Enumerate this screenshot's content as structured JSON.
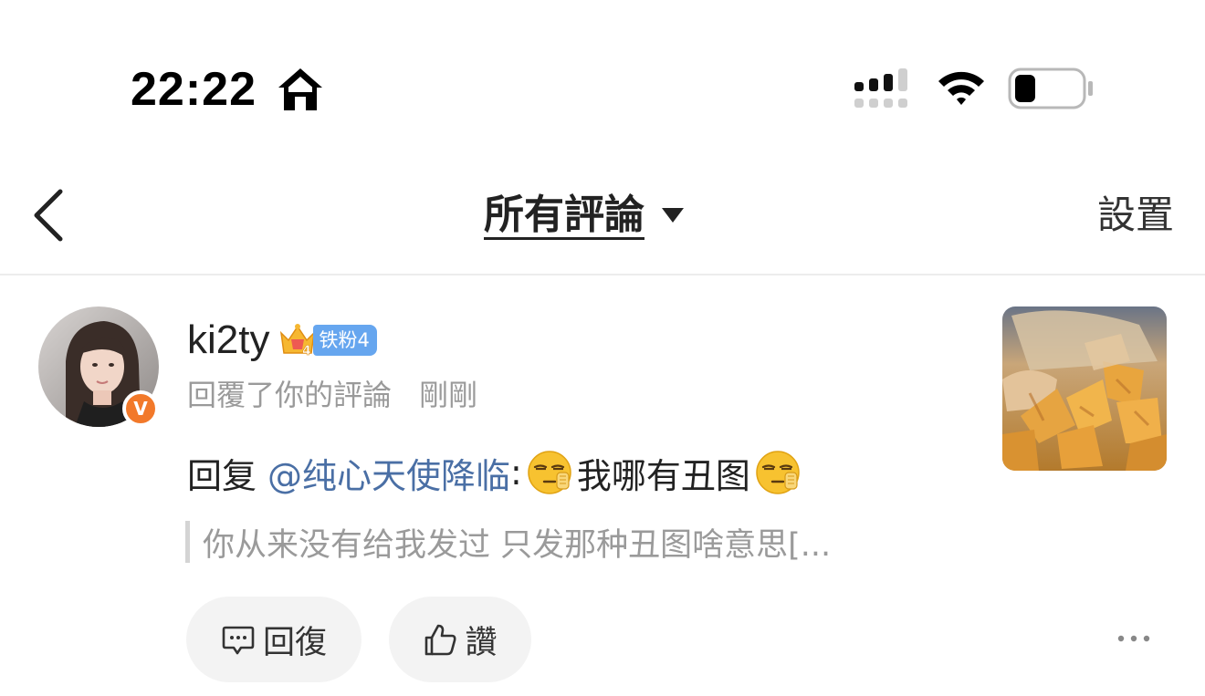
{
  "status_bar": {
    "time": "22:22",
    "icons": [
      "home-icon",
      "signal-icon",
      "wifi-icon",
      "battery-icon"
    ]
  },
  "nav": {
    "back_icon": "chevron-left-icon",
    "title": "所有評論",
    "title_dropdown_icon": "caret-down-icon",
    "settings_label": "設置"
  },
  "comment": {
    "username": "ki2ty",
    "fan_badge": "铁粉4",
    "crown_level": "4",
    "verified_badge": "V",
    "action_text": "回覆了你的評論",
    "time": "剛剛",
    "reply_prefix": "回复",
    "reply_mention": "@纯心天使降临",
    "reply_colon": ":",
    "reply_text": "我哪有丑图",
    "quote_text": "你从来没有给我发过 只发那种丑图啥意思[...",
    "reply_button_label": "回復",
    "like_button_label": "讚"
  },
  "colors": {
    "mention": "#4a6fa5",
    "fan_badge_bg": "#66a6ef",
    "verified_badge_bg": "#f2792a",
    "meta_text": "#9a9a9a",
    "button_bg": "#f3f3f3"
  }
}
